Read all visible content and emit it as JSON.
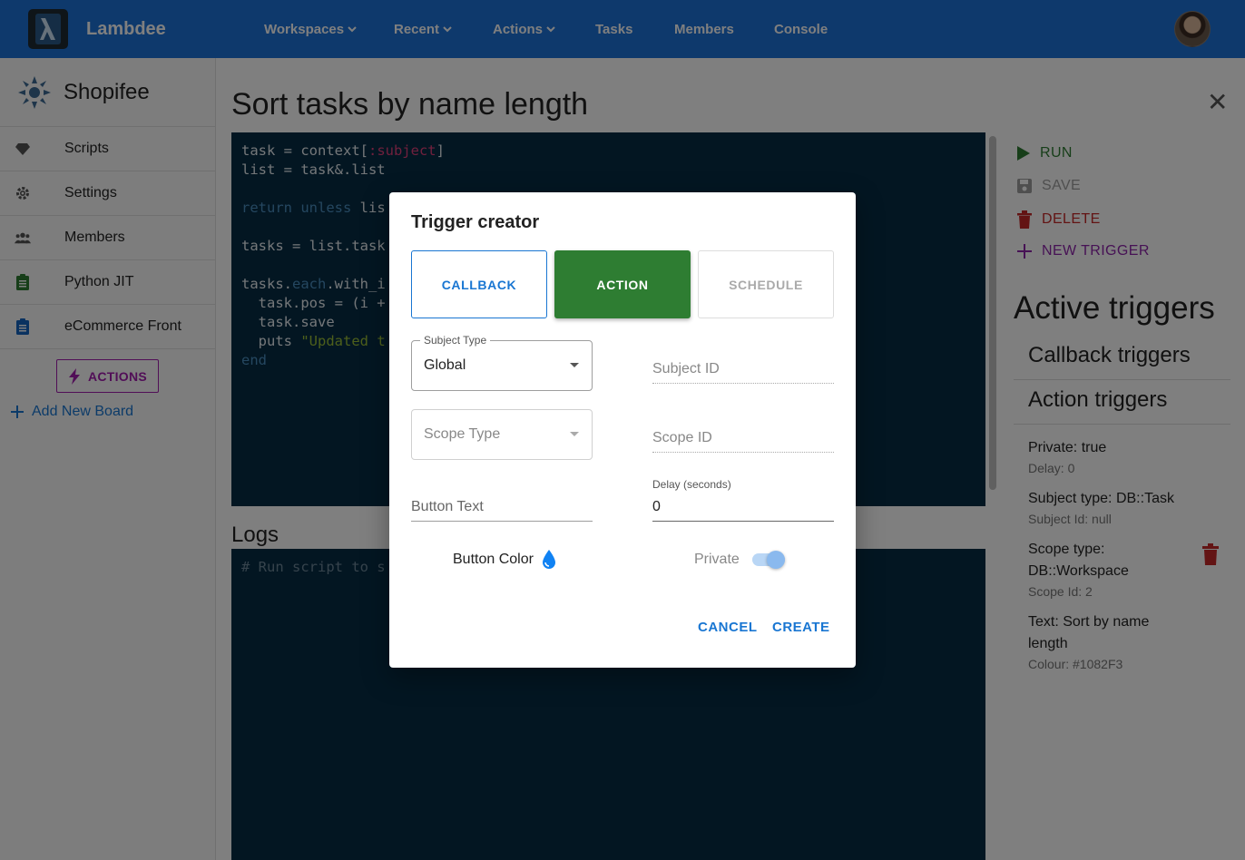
{
  "app": {
    "name": "Lambdee",
    "logo_glyph": "λ"
  },
  "nav": {
    "items": [
      {
        "label": "Workspaces",
        "dropdown": true
      },
      {
        "label": "Recent",
        "dropdown": true
      },
      {
        "label": "Actions",
        "dropdown": true
      },
      {
        "label": "Tasks",
        "dropdown": false
      },
      {
        "label": "Members",
        "dropdown": false
      },
      {
        "label": "Console",
        "dropdown": false
      }
    ]
  },
  "sidebar": {
    "workspace_name": "Shopifee",
    "items": [
      {
        "label": "Scripts",
        "icon": "gem-icon"
      },
      {
        "label": "Settings",
        "icon": "gear-icon"
      },
      {
        "label": "Members",
        "icon": "people-icon"
      },
      {
        "label": "Python JIT",
        "icon": "clipboard-icon"
      },
      {
        "label": "eCommerce Front",
        "icon": "clipboard-icon"
      }
    ],
    "actions_button": "ACTIONS",
    "add_board": "Add New Board"
  },
  "main": {
    "title": "Sort tasks by name length",
    "close_glyph": "✕",
    "code_lines": [
      [
        {
          "t": "task = context["
        },
        {
          "t": ":subject",
          "c": "k-sym"
        },
        {
          "t": "]"
        }
      ],
      [
        {
          "t": "list = task&.list"
        }
      ],
      [
        {
          "t": ""
        }
      ],
      [
        {
          "t": "return unless ",
          "c": "k-kw"
        },
        {
          "t": "lis"
        }
      ],
      [
        {
          "t": ""
        }
      ],
      [
        {
          "t": "tasks = list.task"
        }
      ],
      [
        {
          "t": ""
        }
      ],
      [
        {
          "t": "tasks."
        },
        {
          "t": "each",
          "c": "k-kw"
        },
        {
          "t": ".with_i"
        }
      ],
      [
        {
          "t": "  task.pos = (i +"
        }
      ],
      [
        {
          "t": "  task.save"
        }
      ],
      [
        {
          "t": "  puts "
        },
        {
          "t": "\"Updated t",
          "c": "k-str"
        }
      ],
      [
        {
          "t": "end",
          "c": "k-kw"
        }
      ]
    ],
    "logs_title": "Logs",
    "logs_placeholder": "# Run script to s"
  },
  "right_panel": {
    "actions": [
      {
        "label": "RUN",
        "icon": "play-icon",
        "color": "#2e7d32"
      },
      {
        "label": "SAVE",
        "icon": "floppy-icon",
        "color": "#9e9e9e"
      },
      {
        "label": "DELETE",
        "icon": "trash-icon",
        "color": "#c62828"
      },
      {
        "label": "NEW TRIGGER",
        "icon": "plus-icon",
        "color": "#8e24aa"
      }
    ],
    "active_title": "Active triggers",
    "callback_title": "Callback triggers",
    "action_title": "Action triggers",
    "triggers": [
      {
        "main": "Private: true",
        "sub": "Delay: 0"
      },
      {
        "main": "Subject type: DB::Task",
        "sub": "Subject Id: null"
      },
      {
        "main": "Scope type:",
        "main2": "DB::Workspace",
        "sub": "Scope Id: 2"
      },
      {
        "main": "Text: Sort by name",
        "main2": "length",
        "sub": "Colour: #1082F3"
      }
    ]
  },
  "dialog": {
    "title": "Trigger creator",
    "types": {
      "callback": "CALLBACK",
      "action": "ACTION",
      "schedule": "SCHEDULE"
    },
    "selected_type": "ACTION",
    "subject_type": {
      "label": "Subject Type",
      "value": "Global"
    },
    "subject_id": {
      "placeholder": "Subject ID"
    },
    "scope_type": {
      "placeholder": "Scope Type"
    },
    "scope_id": {
      "placeholder": "Scope ID"
    },
    "button_text": {
      "placeholder": "Button Text"
    },
    "delay": {
      "label": "Delay (seconds)",
      "value": "0"
    },
    "button_color_label": "Button Color",
    "button_color": "#1082F3",
    "private": {
      "label": "Private",
      "checked": true
    },
    "cancel": "CANCEL",
    "create": "CREATE"
  }
}
